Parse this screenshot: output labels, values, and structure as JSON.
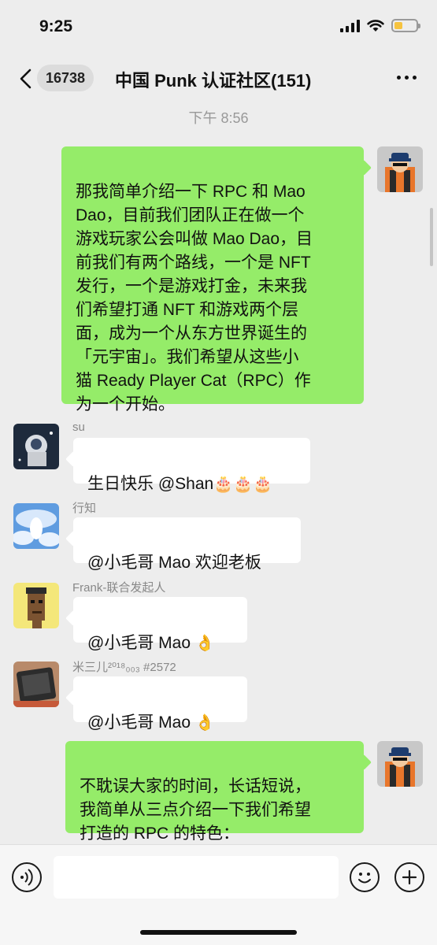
{
  "status_bar": {
    "time": "9:25"
  },
  "nav": {
    "unread_count": "16738",
    "title": "中国 Punk 认证社区(151)"
  },
  "timestamp": "下午 8:56",
  "messages": [
    {
      "direction": "outgoing",
      "text": "那我简单介绍一下 RPC 和 Mao\nDao，目前我们团队正在做一个\n游戏玩家公会叫做 Mao Dao，目\n前我们有两个路线，一个是 NFT\n 发行，一个是游戏打金，未来我\n们希望打通 NFT 和游戏两个层\n面，成为一个从东方世界诞生的\n「元宇宙」。我们希望从这些小\n猫 Ready Player Cat（RPC）作\n为一个开始。"
    },
    {
      "direction": "incoming",
      "sender": "su",
      "text": "生日快乐 @Shan",
      "emoji": "🎂🎂🎂"
    },
    {
      "direction": "incoming",
      "sender": "行知",
      "text": "@小毛哥 Mao 欢迎老板"
    },
    {
      "direction": "incoming",
      "sender": "Frank-联合发起人",
      "text": "@小毛哥 Mao",
      "emoji": "👌"
    },
    {
      "direction": "incoming",
      "sender": "米三儿²⁰¹⁸₀₀₃ #2572",
      "text": "@小毛哥 Mao",
      "emoji": "👌"
    },
    {
      "direction": "outgoing",
      "text": "不耽误大家的时间，长话短说，\n我简单从三点介绍一下我们希望\n打造的 RPC 的特色："
    }
  ],
  "input": {
    "value": ""
  },
  "colors": {
    "outgoing_bubble": "#95ec69",
    "incoming_bubble": "#ffffff",
    "background": "#ededed"
  },
  "icons": [
    "back-arrow-icon",
    "more-icon",
    "voice-icon",
    "emoji-icon",
    "plus-icon",
    "signal-icon",
    "wifi-icon",
    "battery-icon"
  ]
}
